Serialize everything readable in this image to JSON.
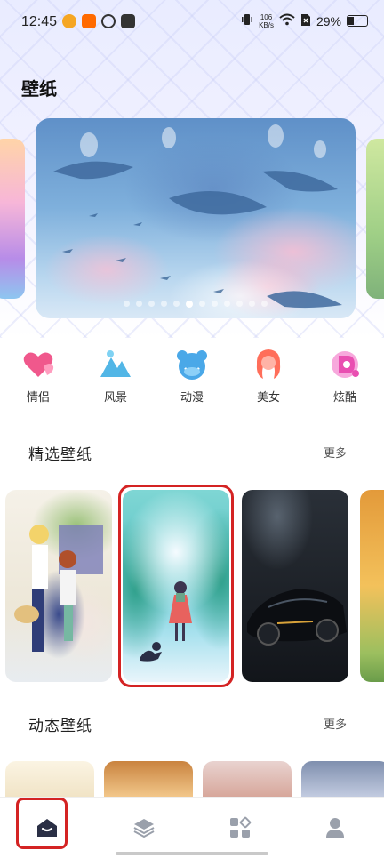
{
  "status_bar": {
    "time": "12:45",
    "net_speed_value": "106",
    "net_speed_unit": "KB/s",
    "battery": "29%"
  },
  "page": {
    "title": "壁纸"
  },
  "banner": {
    "dot_count": 12,
    "active_dot_index": 5
  },
  "categories": [
    {
      "label": "情侣",
      "icon": "heart-icon",
      "color": "#f0588c"
    },
    {
      "label": "风景",
      "icon": "mountain-icon",
      "color": "#52b6e6"
    },
    {
      "label": "动漫",
      "icon": "bear-icon",
      "color": "#4aa8e8"
    },
    {
      "label": "美女",
      "icon": "woman-icon",
      "color": "#ff6e5a"
    },
    {
      "label": "炫酷",
      "icon": "cool-icon",
      "color": "#e94fb1"
    }
  ],
  "featured": {
    "title": "精选壁纸",
    "more": "更多",
    "selected_index": 1
  },
  "dynamic": {
    "title": "动态壁纸",
    "more": "更多"
  },
  "navbar": {
    "items": [
      {
        "name": "home",
        "icon": "home-icon",
        "selected": true
      },
      {
        "name": "layers",
        "icon": "layers-icon",
        "selected": false
      },
      {
        "name": "apps",
        "icon": "apps-icon",
        "selected": false
      },
      {
        "name": "profile",
        "icon": "user-icon",
        "selected": false
      }
    ]
  },
  "colors": {
    "highlight_frame": "#d42323",
    "nav_active": "#2a2f45",
    "nav_inactive": "#9aa0ab"
  }
}
